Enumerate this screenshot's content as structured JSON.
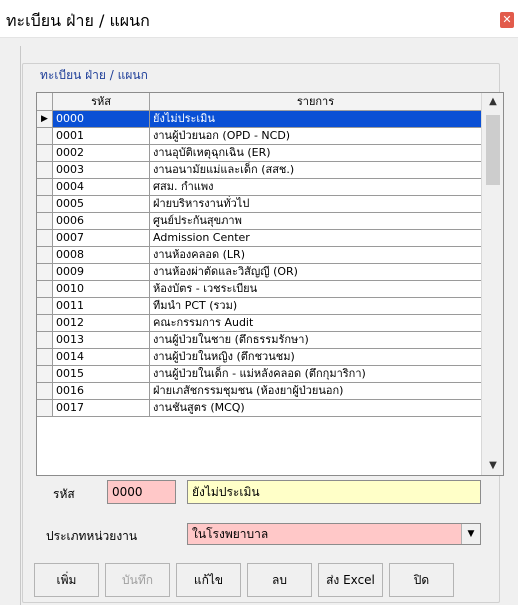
{
  "window": {
    "title": "ทะเบียน ฝ่าย / แผนก",
    "close_icon": "close-icon"
  },
  "group": {
    "caption": "ทะเบียน ฝ่าย / แผนก"
  },
  "grid": {
    "columns": [
      "รหัส",
      "รายการ"
    ],
    "selected_index": 0,
    "rows": [
      {
        "code": "0000",
        "name": "ยังไม่ประเมิน"
      },
      {
        "code": "0001",
        "name": "งานผู้ป่วยนอก (OPD - NCD)"
      },
      {
        "code": "0002",
        "name": "งานอุบัติเหตุฉุกเฉิน (ER)"
      },
      {
        "code": "0003",
        "name": "งานอนามัยแม่และเด็ก (สสช.)"
      },
      {
        "code": "0004",
        "name": "ศสม. กำแพง"
      },
      {
        "code": "0005",
        "name": "ฝ่ายบริหารงานทั่วไป"
      },
      {
        "code": "0006",
        "name": "ศูนย์ประกันสุขภาพ"
      },
      {
        "code": "0007",
        "name": "Admission Center"
      },
      {
        "code": "0008",
        "name": "งานห้องคลอด (LR)"
      },
      {
        "code": "0009",
        "name": "งานห้องผ่าตัดและวิสัญญี (OR)"
      },
      {
        "code": "0010",
        "name": "ห้องบัตร - เวชระเบียน"
      },
      {
        "code": "0011",
        "name": "ทีมนำ PCT (รวม)"
      },
      {
        "code": "0012",
        "name": "คณะกรรมการ Audit"
      },
      {
        "code": "0013",
        "name": "งานผู้ป่วยในชาย (ตึกธรรมรักษา)"
      },
      {
        "code": "0014",
        "name": "งานผู้ป่วยในหญิง (ตึกชวนชม)"
      },
      {
        "code": "0015",
        "name": "งานผู้ป่วยในเด็ก - แม่หลังคลอด (ตึกกุมาริกา)"
      },
      {
        "code": "0016",
        "name": "ฝ่ายเภสัชกรรมชุมชน (ห้องยาผู้ป่วยนอก)"
      },
      {
        "code": "0017",
        "name": "งานชันสูตร (MCQ)"
      }
    ]
  },
  "form": {
    "code_label": "รหัส",
    "code_value": "0000",
    "name_value": "ยังไม่ประเมิน",
    "type_label": "ประเภทหน่วยงาน",
    "type_value": "ในโรงพยาบาล"
  },
  "buttons": {
    "add": "เพิ่ม",
    "save": "บันทึก",
    "edit": "แก้ไข",
    "delete": "ลบ",
    "export": "ส่ง Excel",
    "close": "ปิด"
  },
  "colors": {
    "selection": "#0a50d5",
    "code_field": "#ffc8c8",
    "name_field": "#ffffc8",
    "caption": "#1f3f99"
  }
}
